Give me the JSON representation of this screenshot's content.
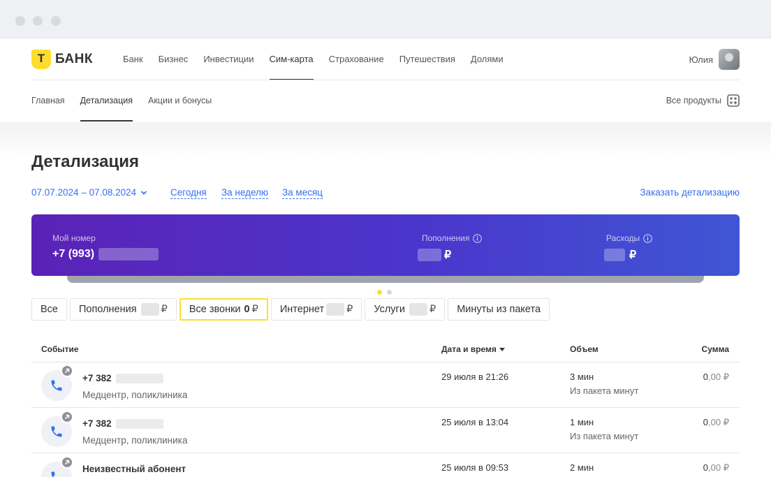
{
  "brand": {
    "logo_text": "БАНК",
    "accent": "#ffdd2d",
    "link_color": "#336fee"
  },
  "top_nav": {
    "items": [
      "Банк",
      "Бизнес",
      "Инвестиции",
      "Сим-карта",
      "Страхование",
      "Путешествия",
      "Долями"
    ],
    "active": "Сим-карта"
  },
  "user": {
    "name": "Юлия"
  },
  "sub_nav": {
    "items": [
      "Главная",
      "Детализация",
      "Акции и бонусы"
    ],
    "active": "Детализация",
    "all_products": "Все продукты"
  },
  "page_title": "Детализация",
  "period": {
    "range": "07.07.2024 – 07.08.2024",
    "quick": [
      "Сегодня",
      "За неделю",
      "За месяц"
    ],
    "order_link": "Заказать детализацию"
  },
  "banner": {
    "my_number_label": "Мой номер",
    "my_number_prefix": "+7 (993)",
    "topups_label": "Пополнения",
    "expenses_label": "Расходы",
    "currency": "₽",
    "gradient": [
      "#5b22b7",
      "#3f56d4"
    ]
  },
  "pager": {
    "pages": 2,
    "current": 1
  },
  "filters": [
    {
      "label": "Все",
      "amount": null,
      "hidden_amount": false
    },
    {
      "label": "Пополнения",
      "amount": "",
      "hidden_amount": true,
      "currency": "₽"
    },
    {
      "label": "Все звонки",
      "amount": "0",
      "hidden_amount": false,
      "currency": "₽",
      "active": true
    },
    {
      "label": "Интернет",
      "amount": "",
      "hidden_amount": true,
      "currency": "₽"
    },
    {
      "label": "Услуги",
      "amount": "",
      "hidden_amount": true,
      "currency": "₽"
    },
    {
      "label": "Минуты из пакета",
      "amount": null,
      "hidden_amount": false
    }
  ],
  "table": {
    "headers": {
      "event": "Событие",
      "datetime": "Дата и время",
      "volume": "Объем",
      "sum": "Сумма"
    },
    "rows": [
      {
        "title": "+7 382",
        "masked": true,
        "subtitle": "Медцентр, поликлиника",
        "date": "29 июля в 21:26",
        "volume": "3 мин",
        "volume_note": "Из пакета минут",
        "sum_int": "0",
        "sum_dec": ",00 ₽",
        "icon": "phone-outgoing-icon"
      },
      {
        "title": "+7 382",
        "masked": true,
        "subtitle": "Медцентр, поликлиника",
        "date": "25 июля в 13:04",
        "volume": "1 мин",
        "volume_note": "Из пакета минут",
        "sum_int": "0",
        "sum_dec": ",00 ₽",
        "icon": "phone-outgoing-icon"
      },
      {
        "title": "Неизвестный абонент",
        "masked": false,
        "subtitle": "",
        "date": "25 июля в 09:53",
        "volume": "2 мин",
        "volume_note": "",
        "sum_int": "0",
        "sum_dec": ",00 ₽",
        "icon": "phone-outgoing-icon"
      }
    ]
  }
}
